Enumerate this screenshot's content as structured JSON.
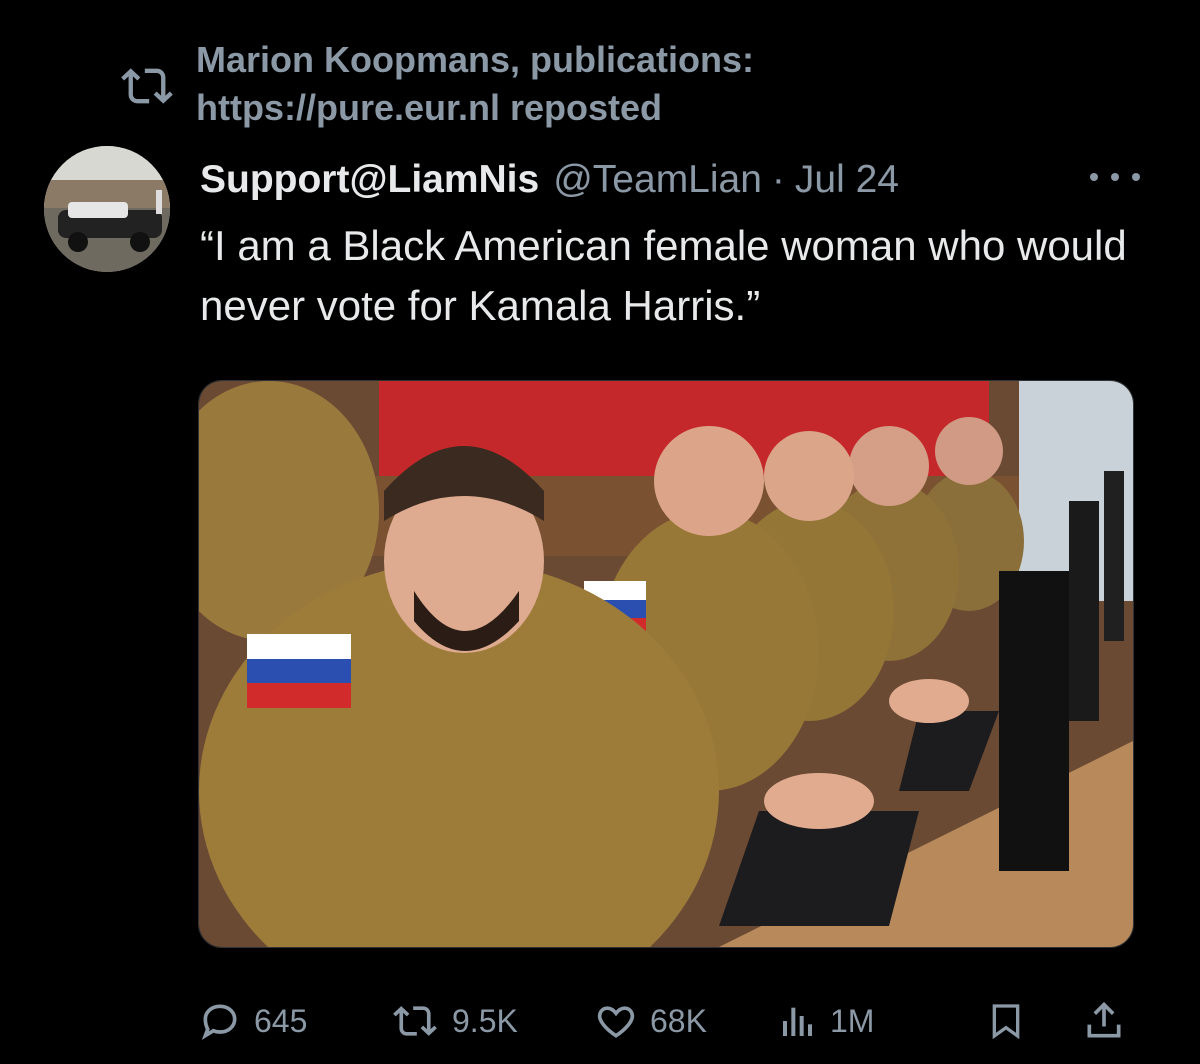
{
  "repost": {
    "icon": "repost-icon",
    "text": "Marion Koopmans, publications: https://pure.eur.nl reposted"
  },
  "tweet": {
    "display_name": "Support@LiamNis",
    "handle": "@TeamLian",
    "separator": "·",
    "date": "Jul 24",
    "text": "“I am a Black American female woman who would never vote for Kamala Harris.”",
    "media": {
      "icon": "photo-image"
    }
  },
  "actions": {
    "replies": "645",
    "reposts": "9.5K",
    "likes": "68K",
    "views": "1M",
    "bookmark_icon": "bookmark-icon",
    "share_icon": "share-icon"
  },
  "colors": {
    "background": "#000000",
    "text_primary": "#e7e9ea",
    "text_secondary": "#8b98a5"
  }
}
